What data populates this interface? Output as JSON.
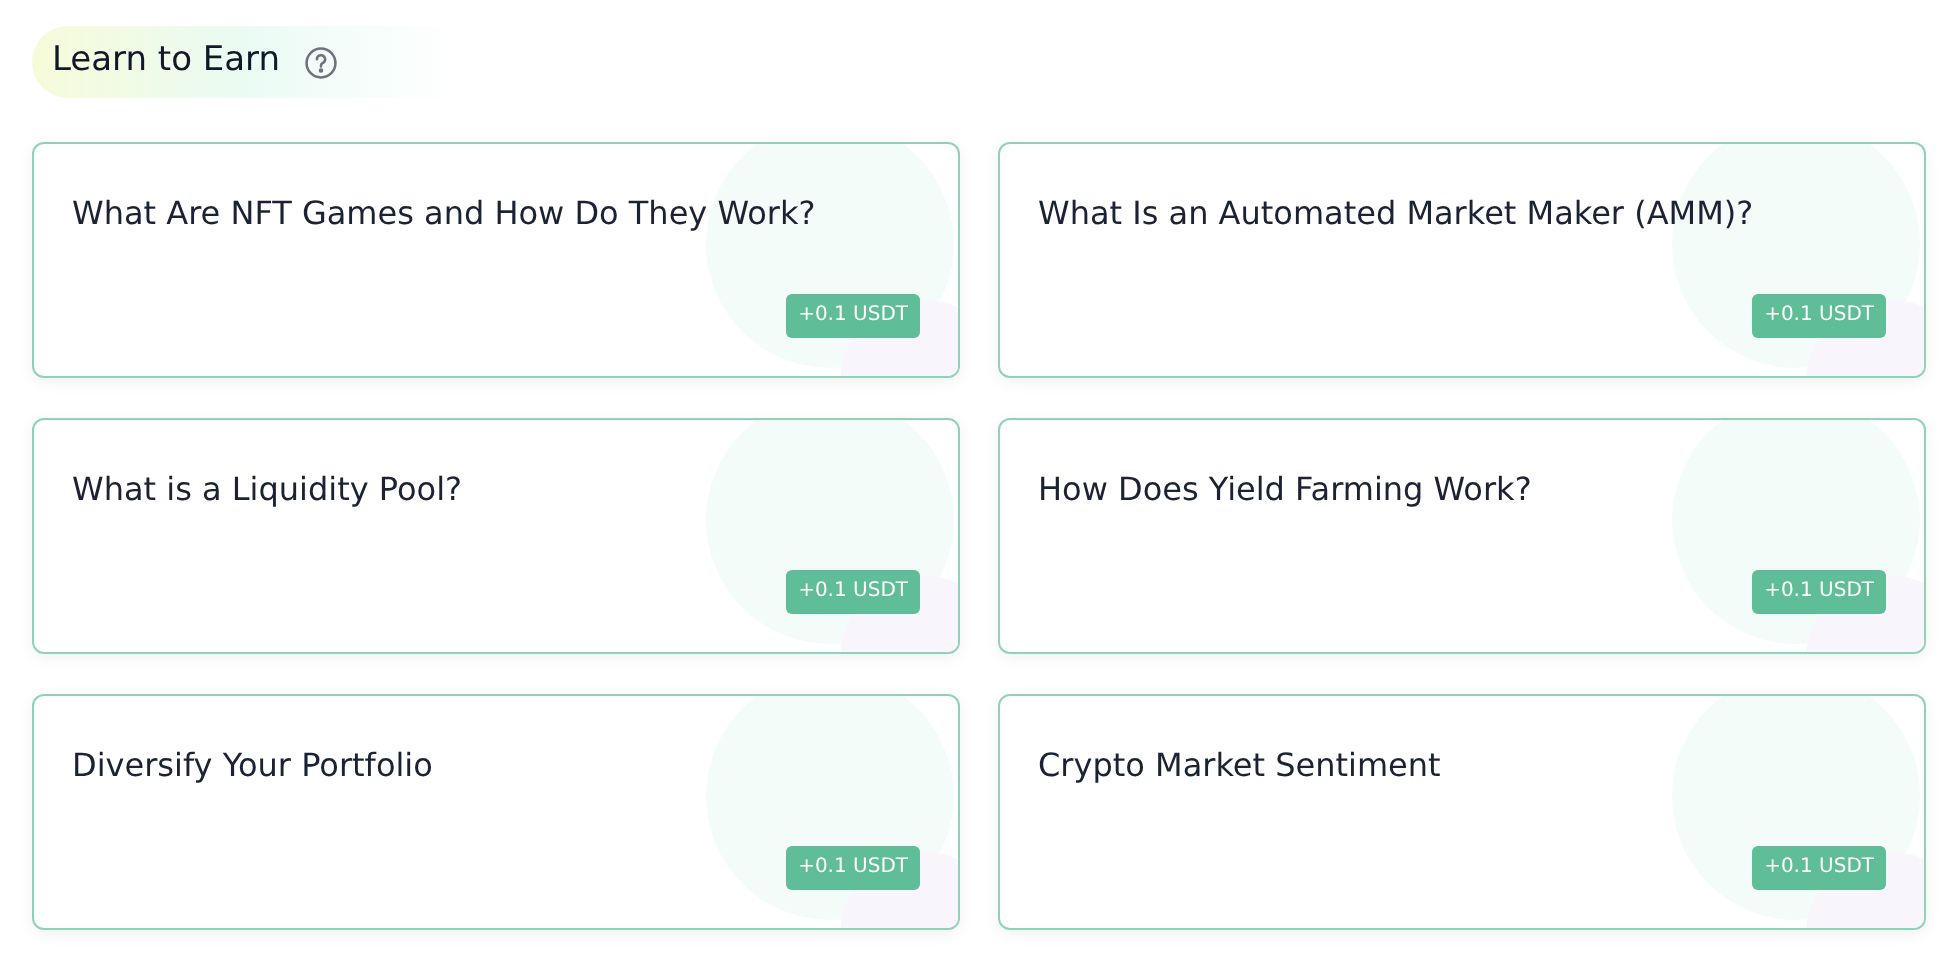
{
  "header": {
    "title": "Learn to Earn"
  },
  "cards": [
    {
      "title": "What Are NFT Games and How Do They Work?",
      "reward": "+0.1 USDT"
    },
    {
      "title": "What Is an Automated Market Maker (AMM)?",
      "reward": "+0.1 USDT"
    },
    {
      "title": "What is a Liquidity Pool?",
      "reward": "+0.1 USDT"
    },
    {
      "title": "How Does Yield Farming Work?",
      "reward": "+0.1 USDT"
    },
    {
      "title": "Diversify Your Portfolio",
      "reward": "+0.1 USDT"
    },
    {
      "title": "Crypto Market Sentiment",
      "reward": "+0.1 USDT"
    }
  ]
}
